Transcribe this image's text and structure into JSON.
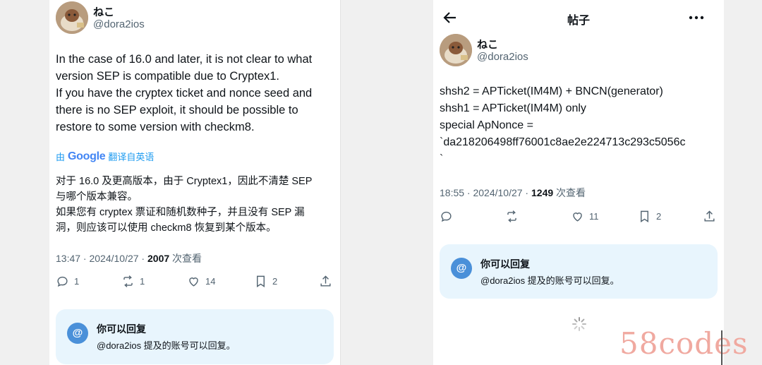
{
  "left": {
    "user": {
      "name": "ねこ",
      "handle": "@dora2ios"
    },
    "tweet_text": "In the case of 16.0 and later, it is not clear to what\nversion SEP is compatible due to Cryptex1.\nIf you have the cryptex ticket and nonce seed and\nthere is no SEP exploit, it should be possible to\nrestore to some version with checkm8.",
    "translate": {
      "by": "由",
      "google": "Google",
      "label": "翻译自英语"
    },
    "translated_text": "对于 16.0 及更高版本，由于 Cryptex1，因此不清楚 SEP\n与哪个版本兼容。\n如果您有 cryptex 票证和随机数种子，并且没有 SEP 漏\n洞，则应该可以使用 checkm8 恢复到某个版本。",
    "meta": {
      "time": "13:47 · 2024/10/27 · ",
      "views": "2007",
      "views_label": " 次查看"
    },
    "actions": {
      "replies": "1",
      "retweets": "1",
      "likes": "14",
      "bookmarks": "2"
    },
    "reply_box": {
      "icon": "@",
      "title": "你可以回复",
      "subtitle": "@dora2ios 提及的账号可以回复。"
    }
  },
  "right": {
    "header": {
      "title": "帖子"
    },
    "user": {
      "name": "ねこ",
      "handle": "@dora2ios"
    },
    "tweet_text": "shsh2 = APTicket(IM4M) + BNCN(generator)\nshsh1 = APTicket(IM4M) only\nspecial ApNonce =\n`da218206498ff76001c8ae2e224713c293c5056c\n`",
    "meta": {
      "time": "18:55 · 2024/10/27 · ",
      "views": "1249",
      "views_label": " 次查看"
    },
    "actions": {
      "replies": "",
      "retweets": "",
      "likes": "11",
      "bookmarks": "2"
    },
    "reply_box": {
      "icon": "@",
      "title": "你可以回复",
      "subtitle": "@dora2ios 提及的账号可以回复。"
    }
  },
  "watermark": "58codes"
}
